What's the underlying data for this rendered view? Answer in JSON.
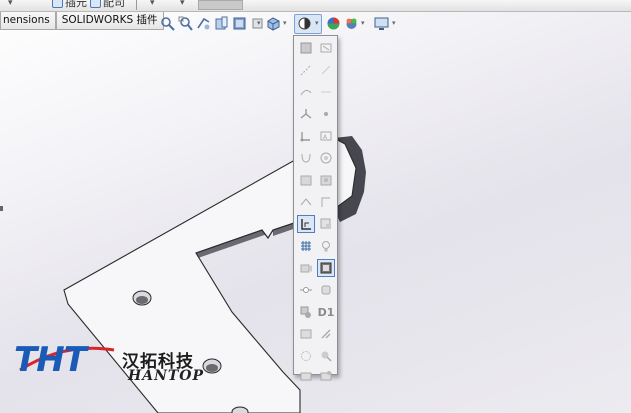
{
  "top_toolbar": {
    "sketch_label": "插元",
    "smart_dim_label": "配司"
  },
  "tabs": [
    {
      "label": "nensions"
    },
    {
      "label": "SOLIDWORKS 插件"
    }
  ],
  "view_toolbar": {
    "icons": [
      "zoom-to-fit-icon",
      "zoom-to-area-icon",
      "previous-view-icon",
      "section-view-icon",
      "dynamic-annotation-icon",
      "view-orientation-icon",
      "hide-show-items-icon",
      "edit-appearance-icon",
      "apply-scene-icon",
      "view-settings-icon"
    ]
  },
  "flyout": {
    "d1_label": "D1",
    "selected_items": [
      "view-sketch-relations-icon",
      "view-origins-icon"
    ]
  },
  "logo": {
    "main": "THT",
    "chinese": "汉拓科技",
    "english": "HANTOP"
  },
  "colors": {
    "logo_blue": "#1a5bb7",
    "logo_red": "#d6262a",
    "selected_bg": "#dbe7f5",
    "part_face": "#f7f7f9",
    "part_edge": "#2a2a2a"
  }
}
